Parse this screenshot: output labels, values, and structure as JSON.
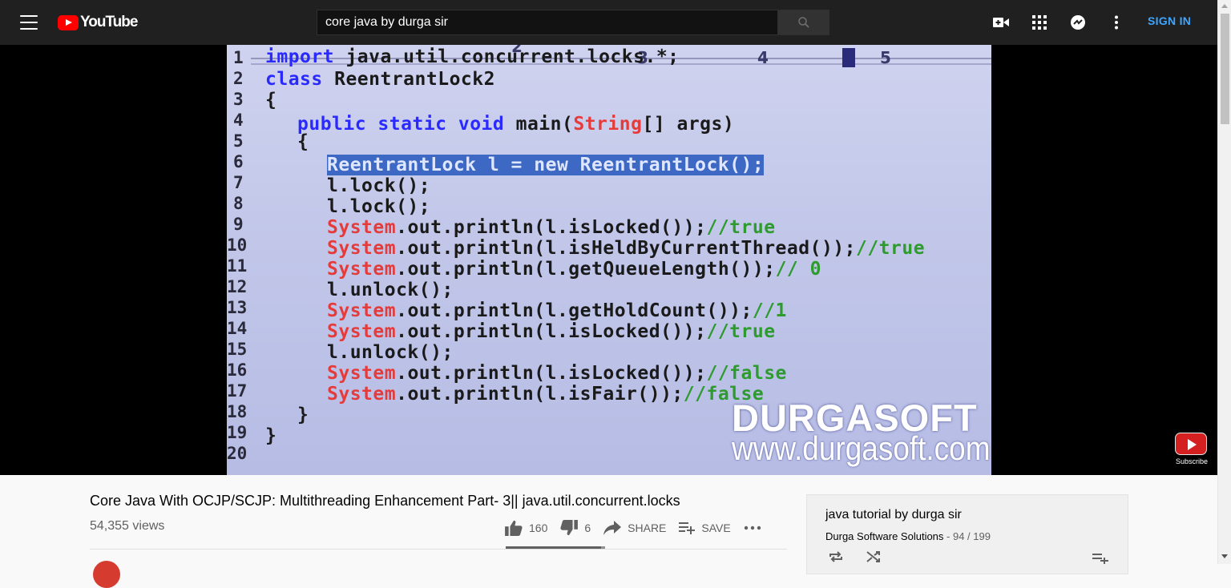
{
  "header": {
    "logo_text": "YouTube",
    "search_value": "core java by durga sir",
    "signin_label": "SIGN IN",
    "icons": [
      "menu-icon",
      "search-icon",
      "create-video-icon",
      "apps-icon",
      "messages-icon",
      "more-vert-icon"
    ]
  },
  "video": {
    "ruler": [
      "2",
      "3",
      "4",
      "5"
    ],
    "line_numbers": [
      "1",
      "2",
      "3",
      "4",
      "5",
      "6",
      "7",
      "8",
      "9",
      "10",
      "11",
      "12",
      "13",
      "14",
      "15",
      "16",
      "17",
      "18",
      "19",
      "20"
    ],
    "code": {
      "l1_kw": "import",
      "l1_rest": " java.util.concurrent.locks.*;",
      "l2_kw": "class",
      "l2_rest": " ReentrantLock2",
      "l3": "{",
      "l4_kw": "public static void",
      "l4_mid": " main(",
      "l4_cls": "String",
      "l4_rest": "[] args)",
      "l5": "{",
      "l6": "ReentrantLock l = new ReentrantLock();",
      "l7": "l.lock();",
      "l8": "l.lock();",
      "l9_cls": "System",
      "l9_rest": ".out.println(l.isLocked());",
      "l9_cm": "//true",
      "l10_cls": "System",
      "l10_rest": ".out.println(l.isHeldByCurrentThread());",
      "l10_cm": "//true",
      "l11_cls": "System",
      "l11_rest": ".out.println(l.getQueueLength());",
      "l11_cm": "// 0",
      "l12": "l.unlock();",
      "l13_cls": "System",
      "l13_rest": ".out.println(l.getHoldCount());",
      "l13_cm": "//1",
      "l14_cls": "System",
      "l14_rest": ".out.println(l.isLocked());",
      "l14_cm": "//true",
      "l15": "l.unlock();",
      "l16_cls": "System",
      "l16_rest": ".out.println(l.isLocked());",
      "l16_cm": "//false",
      "l17_cls": "System",
      "l17_rest": ".out.println(l.isFair());",
      "l17_cm": "//false",
      "l18": "}",
      "l19": "}"
    },
    "watermark_name": "DURGASOFT",
    "watermark_url": "www.durgasoft.com",
    "subscribe_label": "Subscribe"
  },
  "info": {
    "title": "Core Java With OCJP/SCJP: Multithreading Enhancement Part- 3|| java.util.concurrent.locks",
    "views": "54,355 views",
    "likes": "160",
    "dislikes": "6",
    "share_label": "SHARE",
    "save_label": "SAVE",
    "like_ratio": 0.96
  },
  "playlist": {
    "title": "java tutorial by durga sir",
    "channel": "Durga Software Solutions",
    "separator": " - ",
    "position": "94 / 199"
  },
  "colors": {
    "topbar": "#202020",
    "accent_link": "#3ea6ff",
    "brand_red": "#ff0000"
  }
}
